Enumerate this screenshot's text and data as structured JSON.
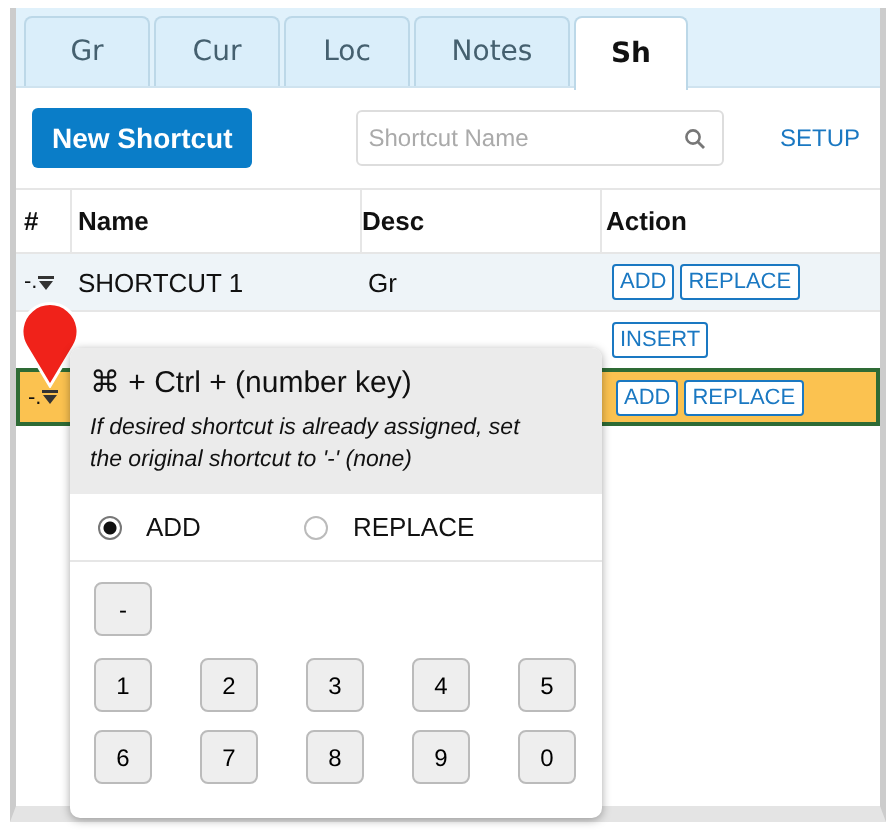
{
  "tabs": [
    {
      "label": "Gr",
      "selected": false
    },
    {
      "label": "Cur",
      "selected": false
    },
    {
      "label": "Loc",
      "selected": false
    },
    {
      "label": "Notes",
      "selected": false
    },
    {
      "label": "Sh",
      "selected": true
    }
  ],
  "toolbar": {
    "new_button": "New Shortcut",
    "search": {
      "placeholder": "Shortcut Name"
    },
    "setup_link": "SETUP"
  },
  "table": {
    "columns": [
      "#",
      "Name",
      "Desc",
      "Action"
    ],
    "rows": [
      {
        "marker": "-.",
        "name": "SHORTCUT 1",
        "desc": "Gr",
        "actions": [
          "ADD",
          "REPLACE"
        ],
        "selected": false
      },
      {
        "actions": [
          "INSERT"
        ],
        "selected": false
      },
      {
        "marker": "-.",
        "actions": [
          "ADD",
          "REPLACE"
        ],
        "selected": true
      }
    ]
  },
  "popover": {
    "title": "⌘ + Ctrl + (number key)",
    "note": "If desired shortcut is already assigned, set the original shortcut to '-' (none)",
    "modes": [
      {
        "label": "ADD",
        "selected": true
      },
      {
        "label": "REPLACE",
        "selected": false
      }
    ],
    "keys": [
      [
        "-"
      ],
      [
        "1",
        "2",
        "3",
        "4",
        "5"
      ],
      [
        "6",
        "7",
        "8",
        "9",
        "0"
      ]
    ]
  }
}
